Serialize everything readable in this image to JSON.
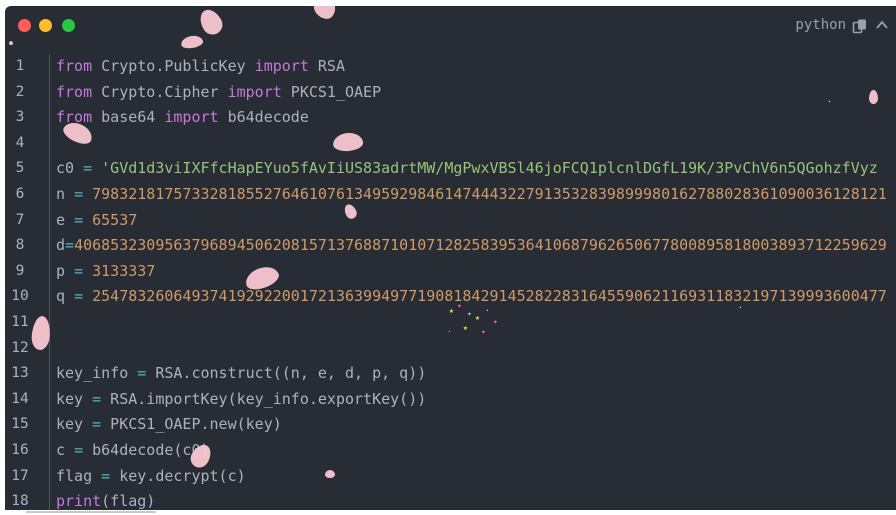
{
  "window": {
    "language_label": "python"
  },
  "icons": {
    "copy": "copy-icon",
    "collapse": "chevron-up-icon"
  },
  "colors": {
    "background": "#282c34",
    "keyword": "#c678dd",
    "number": "#d19a66",
    "string": "#98c379",
    "operator": "#56b6c2",
    "text": "#abb2bf"
  },
  "code": {
    "lines": [
      {
        "num": "1",
        "tokens": [
          [
            "kw",
            "from"
          ],
          [
            "t",
            " Crypto.PublicKey "
          ],
          [
            "kw",
            "import"
          ],
          [
            "t",
            " RSA"
          ]
        ]
      },
      {
        "num": "2",
        "tokens": [
          [
            "kw",
            "from"
          ],
          [
            "t",
            " Crypto.Cipher "
          ],
          [
            "kw",
            "import"
          ],
          [
            "t",
            " PKCS1_OAEP"
          ]
        ]
      },
      {
        "num": "3",
        "tokens": [
          [
            "kw",
            "from"
          ],
          [
            "t",
            " base64 "
          ],
          [
            "kw",
            "import"
          ],
          [
            "t",
            " b64decode"
          ]
        ]
      },
      {
        "num": "4",
        "tokens": []
      },
      {
        "num": "5",
        "tokens": [
          [
            "t",
            "c0 "
          ],
          [
            "op",
            "="
          ],
          [
            "t",
            " "
          ],
          [
            "str",
            "'GVd1d3viIXFfcHapEYuo5fAvIiUS83adrtMW/MgPwxVBSl46joFCQ1plcnlDGfL19K/3PvChV6n5QGohzfVyz"
          ]
        ]
      },
      {
        "num": "6",
        "tokens": [
          [
            "t",
            "n "
          ],
          [
            "op",
            "="
          ],
          [
            "t",
            " "
          ],
          [
            "num",
            "7983218175733281855276461076134959298461474443227913532839899980162788028361090036128121"
          ]
        ]
      },
      {
        "num": "7",
        "tokens": [
          [
            "t",
            "e "
          ],
          [
            "op",
            "="
          ],
          [
            "t",
            " "
          ],
          [
            "num",
            "65537"
          ]
        ]
      },
      {
        "num": "8",
        "tokens": [
          [
            "t",
            "d"
          ],
          [
            "op",
            "="
          ],
          [
            "num",
            "406853230956379689450620815713768871010712825839536410687962650677800895818003893712259629"
          ]
        ]
      },
      {
        "num": "9",
        "tokens": [
          [
            "t",
            "p "
          ],
          [
            "op",
            "="
          ],
          [
            "t",
            " "
          ],
          [
            "num",
            "3133337"
          ]
        ]
      },
      {
        "num": "10",
        "tokens": [
          [
            "t",
            "q "
          ],
          [
            "op",
            "="
          ],
          [
            "t",
            " "
          ],
          [
            "num",
            "2547832606493741929220017213639949771908184291452822831645590621169311832197139993600477"
          ]
        ]
      },
      {
        "num": "11",
        "tokens": []
      },
      {
        "num": "12",
        "tokens": []
      },
      {
        "num": "13",
        "tokens": [
          [
            "t",
            "key_info "
          ],
          [
            "op",
            "="
          ],
          [
            "t",
            " RSA.construct((n, e, d, p, q))"
          ]
        ]
      },
      {
        "num": "14",
        "tokens": [
          [
            "t",
            "key "
          ],
          [
            "op",
            "="
          ],
          [
            "t",
            " RSA.importKey(key_info.exportKey())"
          ]
        ]
      },
      {
        "num": "15",
        "tokens": [
          [
            "t",
            "key "
          ],
          [
            "op",
            "="
          ],
          [
            "t",
            " PKCS1_OAEP.new(key)"
          ]
        ]
      },
      {
        "num": "16",
        "tokens": [
          [
            "t",
            "c "
          ],
          [
            "op",
            "="
          ],
          [
            "t",
            " b64decode(c0)"
          ]
        ]
      },
      {
        "num": "17",
        "tokens": [
          [
            "t",
            "flag "
          ],
          [
            "op",
            "="
          ],
          [
            "t",
            " key.decrypt(c)"
          ]
        ]
      },
      {
        "num": "18",
        "tokens": [
          [
            "kw",
            "print"
          ],
          [
            "t",
            "(flag)"
          ]
        ]
      }
    ]
  }
}
